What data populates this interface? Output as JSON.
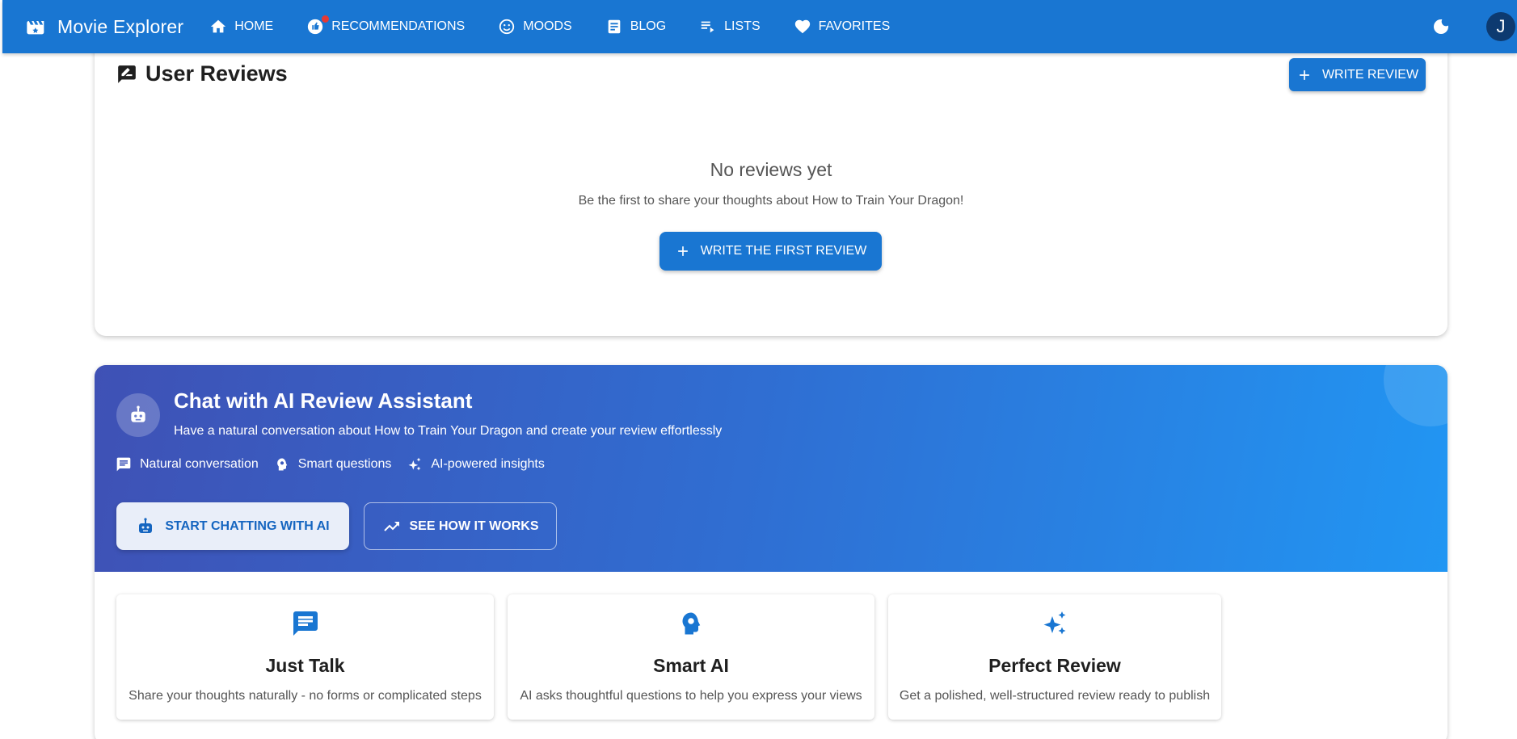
{
  "appbar": {
    "brand_title": "Movie Explorer",
    "nav": [
      {
        "label": "HOME",
        "icon": "home-icon"
      },
      {
        "label": "RECOMMENDATIONS",
        "icon": "recommendations-icon",
        "has_notification": true
      },
      {
        "label": "MOODS",
        "icon": "mood-icon"
      },
      {
        "label": "BLOG",
        "icon": "article-icon"
      },
      {
        "label": "LISTS",
        "icon": "playlist-icon"
      },
      {
        "label": "FAVORITES",
        "icon": "heart-icon"
      }
    ],
    "theme_icon": "dark-mode-icon",
    "avatar_initial": "J"
  },
  "reviews": {
    "title": "User Reviews",
    "write_button": "WRITE REVIEW",
    "empty_title": "No reviews yet",
    "empty_subtitle": "Be the first to share your thoughts about How to Train Your Dragon!",
    "first_review_button": "WRITE THE FIRST REVIEW"
  },
  "ai_assistant": {
    "title": "Chat with AI Review Assistant",
    "subtitle": "Have a natural conversation about How to Train Your Dragon and create your review effortlessly",
    "features": [
      {
        "label": "Natural conversation",
        "icon": "chat-icon"
      },
      {
        "label": "Smart questions",
        "icon": "psychology-icon"
      },
      {
        "label": "AI-powered insights",
        "icon": "sparkle-icon"
      }
    ],
    "primary_button": "START CHATTING WITH AI",
    "secondary_button": "SEE HOW IT WORKS",
    "tiles": [
      {
        "title": "Just Talk",
        "description": "Share your thoughts naturally - no forms or complicated steps",
        "icon": "chat-icon"
      },
      {
        "title": "Smart AI",
        "description": "AI asks thoughtful questions to help you express your views",
        "icon": "psychology-icon"
      },
      {
        "title": "Perfect Review",
        "description": "Get a polished, well-structured review ready to publish",
        "icon": "sparkle-icon"
      }
    ]
  },
  "colors": {
    "primary": "#1976d2",
    "hero_gradient_start": "#3f51b5",
    "hero_gradient_end": "#2196f3",
    "notification_dot": "#e53935"
  }
}
